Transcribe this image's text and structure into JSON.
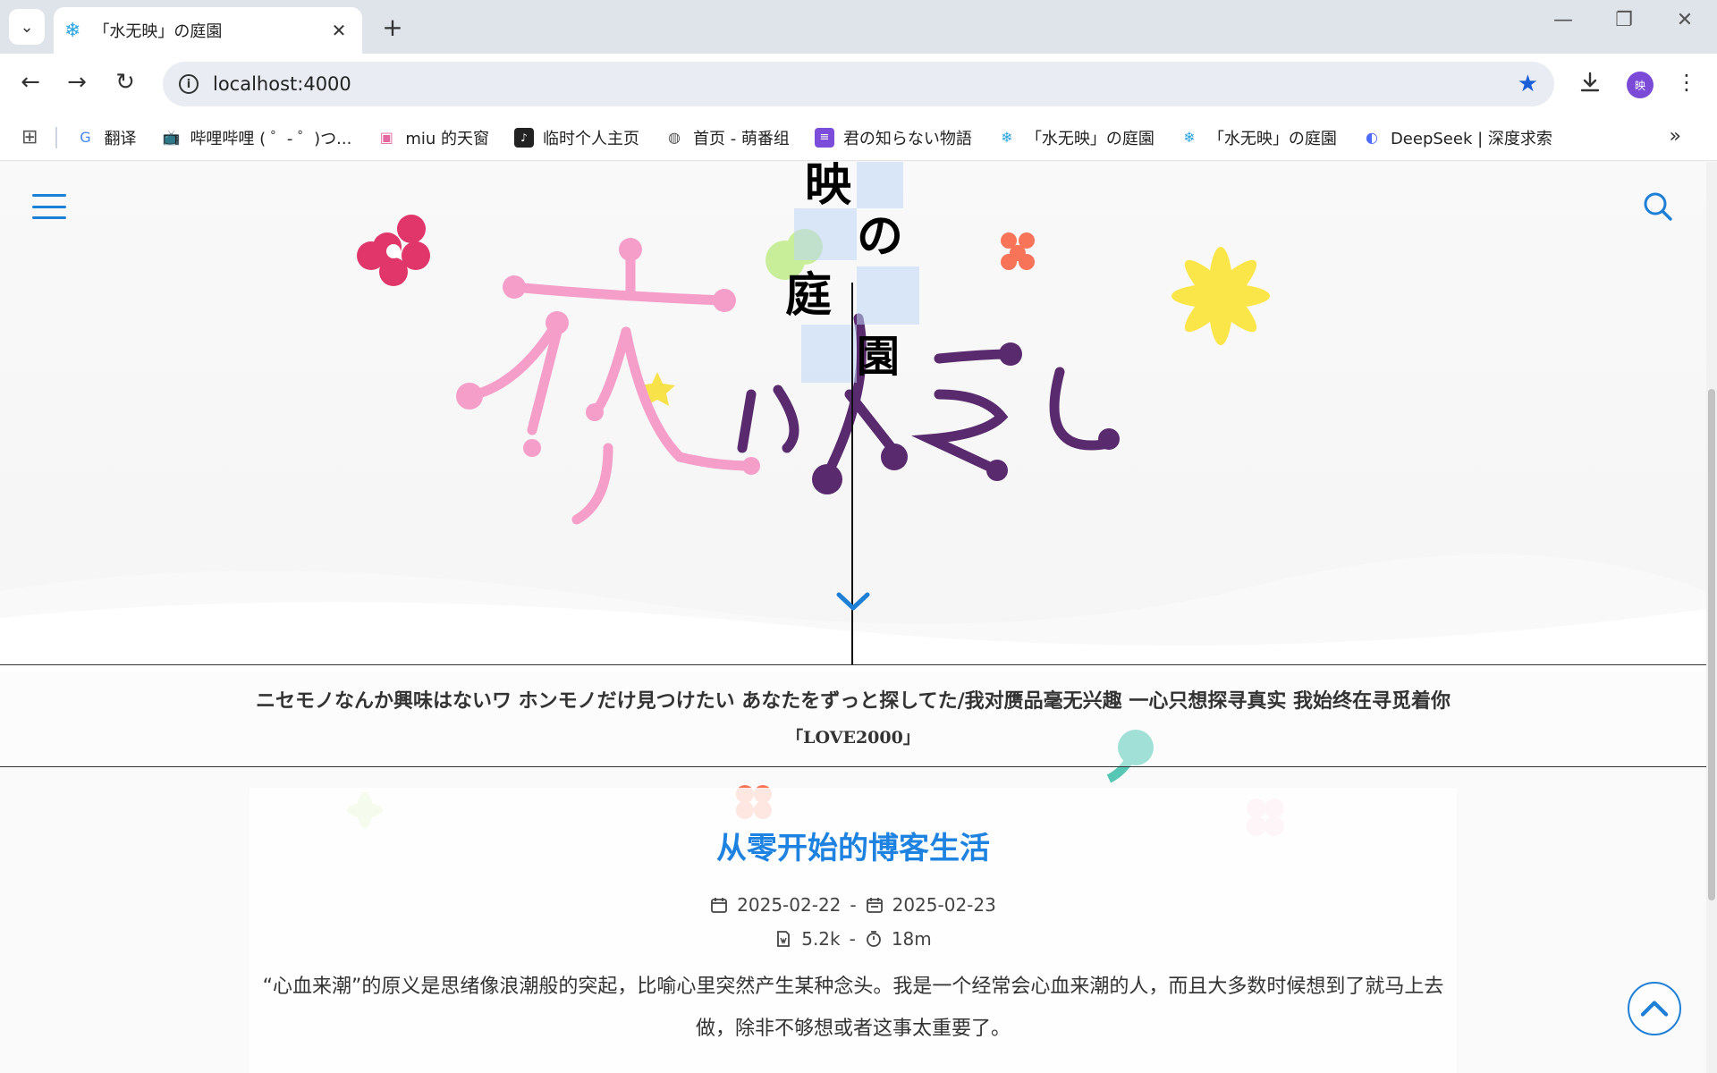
{
  "browser": {
    "tab_title": "「水无映」の庭園",
    "url": "localhost:4000",
    "avatar_label": "映"
  },
  "bookmarks": [
    {
      "label": "翻译",
      "icon": "google-translate-icon",
      "color": "#4285f4"
    },
    {
      "label": "哔哩哔哩 ( ゜- ゜)つ...",
      "icon": "bilibili-icon",
      "color": "#00a1d6"
    },
    {
      "label": "miu 的天窗",
      "icon": "tv-icon",
      "color": "#e26aa0"
    },
    {
      "label": "临时个人主页",
      "icon": "image-icon",
      "color": "#222"
    },
    {
      "label": "首页 - 萌番组",
      "icon": "globe-icon",
      "color": "#555"
    },
    {
      "label": "君の知らない物語",
      "icon": "document-icon",
      "color": "#7c4ddb"
    },
    {
      "label": "「水无映」の庭園",
      "icon": "snowflake-icon",
      "color": "#2aa4e0"
    },
    {
      "label": "「水无映」の庭園",
      "icon": "snowflake-icon",
      "color": "#2aa4e0"
    },
    {
      "label": "DeepSeek | 深度求索",
      "icon": "deepseek-icon",
      "color": "#4d6bfe"
    }
  ],
  "hero": {
    "title_chars": [
      "映",
      "の",
      "庭",
      "園"
    ],
    "accent_color": "#1e7fd6"
  },
  "quote": {
    "text": "ニセモノなんか興味はないワ ホンモノだけ見つけたい あなたをずっと探してた/我对赝品毫无兴趣 一心只想探寻真实 我始终在寻觅着你",
    "source": "「LOVE2000」"
  },
  "post": {
    "title": "从零开始的博客生活",
    "created": "2025-02-22",
    "updated": "2025-02-23",
    "separator": "-",
    "word_count": "5.2k",
    "read_time": "18m",
    "excerpt": "“心血来潮”的原义是思绪像浪潮般的突起，比喻心里突然产生某种念头。我是一个经常会心血来潮的人，而且大多数时候想到了就马上去做，除非不够想或者这事太重要了。"
  }
}
